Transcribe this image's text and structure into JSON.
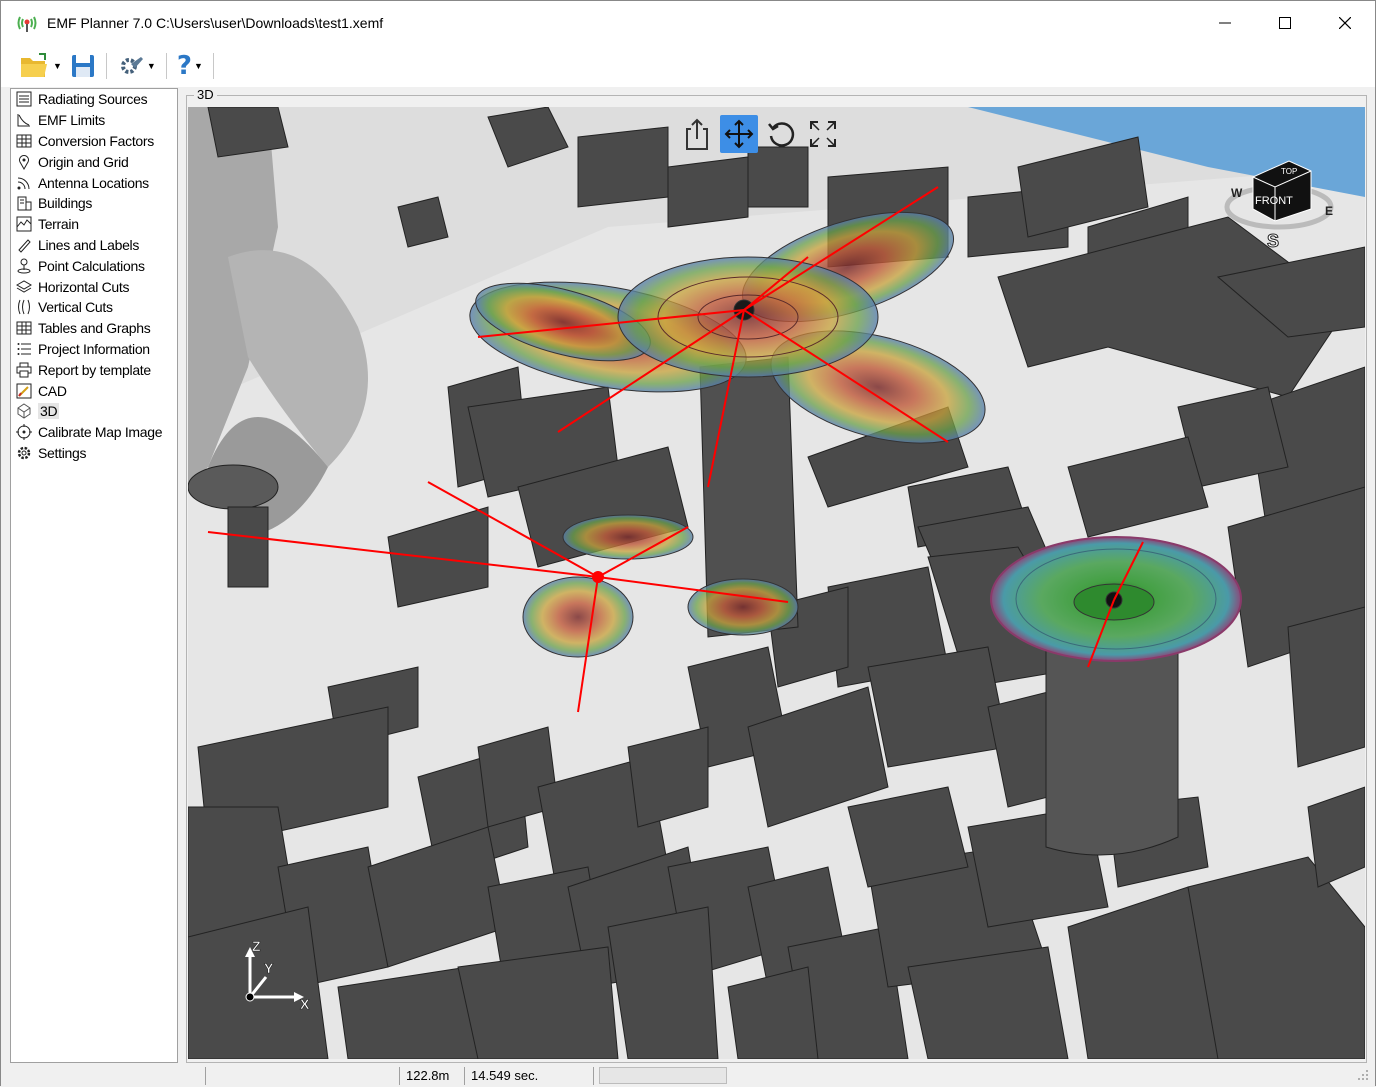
{
  "window": {
    "title": "EMF Planner 7.0 C:\\Users\\user\\Downloads\\test1.xemf"
  },
  "toolbar": {
    "items": [
      {
        "name": "open-folder-icon"
      },
      {
        "name": "save-icon"
      },
      {
        "name": "tools-icon"
      },
      {
        "name": "help-icon"
      }
    ]
  },
  "sidebar": {
    "items": [
      {
        "label": "Radiating Sources",
        "icon": "list-icon"
      },
      {
        "label": "EMF Limits",
        "icon": "limits-icon"
      },
      {
        "label": "Conversion Factors",
        "icon": "grid-table-icon"
      },
      {
        "label": "Origin and Grid",
        "icon": "pin-icon"
      },
      {
        "label": "Antenna Locations",
        "icon": "signal-icon"
      },
      {
        "label": "Buildings",
        "icon": "building-icon"
      },
      {
        "label": "Terrain",
        "icon": "terrain-icon"
      },
      {
        "label": "Lines and Labels",
        "icon": "pencil-icon"
      },
      {
        "label": "Point Calculations",
        "icon": "person-pin-icon"
      },
      {
        "label": "Horizontal Cuts",
        "icon": "layers-icon"
      },
      {
        "label": "Vertical Cuts",
        "icon": "vertical-cuts-icon"
      },
      {
        "label": "Tables and Graphs",
        "icon": "table-icon"
      },
      {
        "label": "Project Information",
        "icon": "info-list-icon"
      },
      {
        "label": "Report by template",
        "icon": "printer-icon"
      },
      {
        "label": "CAD",
        "icon": "cad-icon"
      },
      {
        "label": "3D",
        "icon": "3d-icon"
      },
      {
        "label": "Calibrate Map Image",
        "icon": "crosshair-icon"
      },
      {
        "label": "Settings",
        "icon": "gear-icon"
      }
    ],
    "selected": "3D"
  },
  "view": {
    "tab_label": "3D",
    "tools": [
      "share-icon",
      "move-icon",
      "rotate-icon",
      "fullscreen-icon"
    ],
    "navcube": {
      "face": "FRONT",
      "top": "TOP",
      "west": "W",
      "east": "E",
      "south": "S"
    },
    "axes": {
      "x": "X",
      "y": "Y",
      "z": "Z"
    }
  },
  "status": {
    "distance": "122.8m",
    "time": "14.549 sec."
  },
  "colors": {
    "building": "#4a4a4a",
    "ground": "#dcdcdc",
    "water": "#6aa6d8",
    "field_line": "#ff0000",
    "accent": "#3d8ee6"
  }
}
